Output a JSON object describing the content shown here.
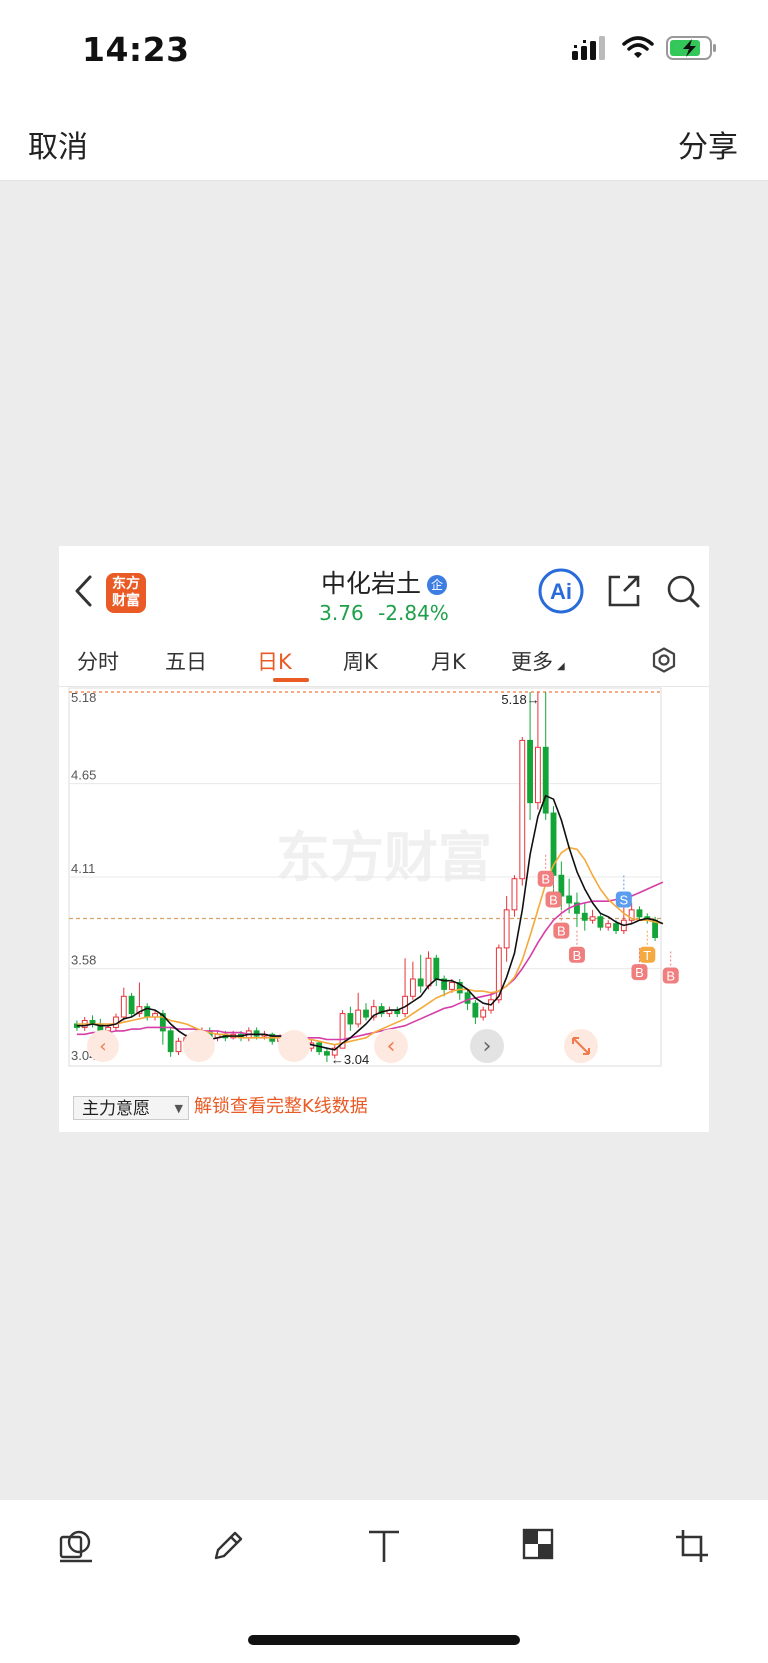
{
  "status": {
    "time": "14:23"
  },
  "topbar": {
    "cancel": "取消",
    "share": "分享"
  },
  "app": {
    "logo_text_line1": "东方",
    "logo_text_line2": "财富",
    "stock_name": "中化岩土",
    "badge": "企",
    "price": "3.76",
    "change_pct": "-2.84%",
    "ai_label": "Ai"
  },
  "tabs": [
    "分时",
    "五日",
    "日K",
    "周K",
    "月K",
    "更多"
  ],
  "active_tab": "日K",
  "indicator": {
    "label": "主力意愿",
    "unlock_text": "解锁查看完整K线数据"
  },
  "watermark": "东方财富",
  "colors": {
    "up": "#e8333a",
    "down": "#13a538",
    "accent": "#ea5a24",
    "ma5": "#111111",
    "ma10": "#f4a93a",
    "ma20": "#d63ca8"
  },
  "chart_data": {
    "type": "candlestick",
    "y_ticks": [
      "5.18",
      "4.65",
      "4.11",
      "3.58",
      "3.04"
    ],
    "ylim": [
      3.04,
      5.18
    ],
    "high_label": "5.18",
    "low_label": "3.04",
    "reference_price": 3.87,
    "candles": [
      {
        "o": 3.26,
        "c": 3.24,
        "h": 3.28,
        "l": 3.22
      },
      {
        "o": 3.24,
        "c": 3.28,
        "h": 3.3,
        "l": 3.22
      },
      {
        "o": 3.28,
        "c": 3.26,
        "h": 3.31,
        "l": 3.24
      },
      {
        "o": 3.26,
        "c": 3.22,
        "h": 3.29,
        "l": 3.18
      },
      {
        "o": 3.22,
        "c": 3.24,
        "h": 3.26,
        "l": 3.2
      },
      {
        "o": 3.24,
        "c": 3.3,
        "h": 3.32,
        "l": 3.22
      },
      {
        "o": 3.3,
        "c": 3.42,
        "h": 3.47,
        "l": 3.28
      },
      {
        "o": 3.42,
        "c": 3.32,
        "h": 3.44,
        "l": 3.3
      },
      {
        "o": 3.32,
        "c": 3.36,
        "h": 3.5,
        "l": 3.3
      },
      {
        "o": 3.36,
        "c": 3.3,
        "h": 3.38,
        "l": 3.28
      },
      {
        "o": 3.3,
        "c": 3.32,
        "h": 3.34,
        "l": 3.28
      },
      {
        "o": 3.32,
        "c": 3.22,
        "h": 3.34,
        "l": 3.14
      },
      {
        "o": 3.22,
        "c": 3.1,
        "h": 3.24,
        "l": 3.07
      },
      {
        "o": 3.1,
        "c": 3.16,
        "h": 3.18,
        "l": 3.08
      },
      {
        "o": 3.16,
        "c": 3.18,
        "h": 3.2,
        "l": 3.12
      },
      {
        "o": 3.18,
        "c": 3.14,
        "h": 3.2,
        "l": 3.12
      },
      {
        "o": 3.14,
        "c": 3.22,
        "h": 3.24,
        "l": 3.12
      },
      {
        "o": 3.22,
        "c": 3.18,
        "h": 3.24,
        "l": 3.16
      },
      {
        "o": 3.18,
        "c": 3.2,
        "h": 3.22,
        "l": 3.16
      },
      {
        "o": 3.2,
        "c": 3.18,
        "h": 3.22,
        "l": 3.16
      },
      {
        "o": 3.18,
        "c": 3.2,
        "h": 3.22,
        "l": 3.17
      },
      {
        "o": 3.2,
        "c": 3.18,
        "h": 3.22,
        "l": 3.16
      },
      {
        "o": 3.18,
        "c": 3.22,
        "h": 3.24,
        "l": 3.16
      },
      {
        "o": 3.22,
        "c": 3.19,
        "h": 3.24,
        "l": 3.17
      },
      {
        "o": 3.19,
        "c": 3.2,
        "h": 3.22,
        "l": 3.17
      },
      {
        "o": 3.2,
        "c": 3.16,
        "h": 3.21,
        "l": 3.14
      },
      {
        "o": 3.16,
        "c": 3.18,
        "h": 3.2,
        "l": 3.14
      },
      {
        "o": 3.18,
        "c": 3.14,
        "h": 3.19,
        "l": 3.12
      },
      {
        "o": 3.14,
        "c": 3.16,
        "h": 3.18,
        "l": 3.12
      },
      {
        "o": 3.16,
        "c": 3.12,
        "h": 3.18,
        "l": 3.1
      },
      {
        "o": 3.12,
        "c": 3.15,
        "h": 3.17,
        "l": 3.1
      },
      {
        "o": 3.15,
        "c": 3.1,
        "h": 3.16,
        "l": 3.08
      },
      {
        "o": 3.1,
        "c": 3.08,
        "h": 3.12,
        "l": 3.04
      },
      {
        "o": 3.08,
        "c": 3.12,
        "h": 3.14,
        "l": 3.06
      },
      {
        "o": 3.12,
        "c": 3.32,
        "h": 3.34,
        "l": 3.12
      },
      {
        "o": 3.32,
        "c": 3.26,
        "h": 3.36,
        "l": 3.22
      },
      {
        "o": 3.26,
        "c": 3.34,
        "h": 3.44,
        "l": 3.24
      },
      {
        "o": 3.34,
        "c": 3.3,
        "h": 3.38,
        "l": 3.28
      },
      {
        "o": 3.3,
        "c": 3.36,
        "h": 3.4,
        "l": 3.28
      },
      {
        "o": 3.36,
        "c": 3.32,
        "h": 3.38,
        "l": 3.3
      },
      {
        "o": 3.32,
        "c": 3.34,
        "h": 3.36,
        "l": 3.3
      },
      {
        "o": 3.34,
        "c": 3.32,
        "h": 3.36,
        "l": 3.3
      },
      {
        "o": 3.32,
        "c": 3.42,
        "h": 3.64,
        "l": 3.3
      },
      {
        "o": 3.42,
        "c": 3.52,
        "h": 3.62,
        "l": 3.4
      },
      {
        "o": 3.52,
        "c": 3.48,
        "h": 3.66,
        "l": 3.44
      },
      {
        "o": 3.48,
        "c": 3.64,
        "h": 3.68,
        "l": 3.46
      },
      {
        "o": 3.64,
        "c": 3.52,
        "h": 3.66,
        "l": 3.48
      },
      {
        "o": 3.52,
        "c": 3.46,
        "h": 3.54,
        "l": 3.42
      },
      {
        "o": 3.46,
        "c": 3.5,
        "h": 3.52,
        "l": 3.44
      },
      {
        "o": 3.5,
        "c": 3.44,
        "h": 3.52,
        "l": 3.4
      },
      {
        "o": 3.44,
        "c": 3.38,
        "h": 3.46,
        "l": 3.34
      },
      {
        "o": 3.38,
        "c": 3.3,
        "h": 3.4,
        "l": 3.26
      },
      {
        "o": 3.3,
        "c": 3.34,
        "h": 3.36,
        "l": 3.28
      },
      {
        "o": 3.34,
        "c": 3.4,
        "h": 3.44,
        "l": 3.32
      },
      {
        "o": 3.4,
        "c": 3.7,
        "h": 3.72,
        "l": 3.38
      },
      {
        "o": 3.7,
        "c": 3.92,
        "h": 4.0,
        "l": 3.62
      },
      {
        "o": 3.92,
        "c": 4.1,
        "h": 4.12,
        "l": 3.88
      },
      {
        "o": 4.1,
        "c": 4.9,
        "h": 4.92,
        "l": 4.06
      },
      {
        "o": 4.9,
        "c": 4.54,
        "h": 5.18,
        "l": 4.44
      },
      {
        "o": 4.54,
        "c": 4.86,
        "h": 5.18,
        "l": 4.5
      },
      {
        "o": 4.86,
        "c": 4.48,
        "h": 5.18,
        "l": 4.44
      },
      {
        "o": 4.48,
        "c": 4.12,
        "h": 4.52,
        "l": 4.0
      },
      {
        "o": 4.12,
        "c": 4.0,
        "h": 4.2,
        "l": 3.92
      },
      {
        "o": 4.0,
        "c": 3.96,
        "h": 4.1,
        "l": 3.9
      },
      {
        "o": 3.96,
        "c": 3.9,
        "h": 4.02,
        "l": 3.82
      },
      {
        "o": 3.9,
        "c": 3.86,
        "h": 3.96,
        "l": 3.8
      },
      {
        "o": 3.86,
        "c": 3.88,
        "h": 3.92,
        "l": 3.84
      },
      {
        "o": 3.88,
        "c": 3.82,
        "h": 3.9,
        "l": 3.8
      },
      {
        "o": 3.82,
        "c": 3.84,
        "h": 3.86,
        "l": 3.8
      },
      {
        "o": 3.84,
        "c": 3.8,
        "h": 3.86,
        "l": 3.78
      },
      {
        "o": 3.8,
        "c": 3.86,
        "h": 3.94,
        "l": 3.78
      },
      {
        "o": 3.86,
        "c": 3.92,
        "h": 3.96,
        "l": 3.84
      },
      {
        "o": 3.92,
        "c": 3.88,
        "h": 3.94,
        "l": 3.86
      },
      {
        "o": 3.88,
        "c": 3.86,
        "h": 3.9,
        "l": 3.84
      },
      {
        "o": 3.86,
        "c": 3.76,
        "h": 3.88,
        "l": 3.74
      }
    ],
    "ma5": [
      3.25,
      3.25,
      3.26,
      3.25,
      3.25,
      3.26,
      3.29,
      3.3,
      3.33,
      3.35,
      3.34,
      3.31,
      3.26,
      3.22,
      3.19,
      3.16,
      3.16,
      3.17,
      3.18,
      3.19,
      3.19,
      3.19,
      3.2,
      3.2,
      3.2,
      3.19,
      3.19,
      3.17,
      3.16,
      3.15,
      3.14,
      3.13,
      3.12,
      3.11,
      3.15,
      3.18,
      3.22,
      3.26,
      3.31,
      3.33,
      3.34,
      3.34,
      3.36,
      3.39,
      3.42,
      3.48,
      3.52,
      3.51,
      3.51,
      3.49,
      3.46,
      3.41,
      3.38,
      3.37,
      3.42,
      3.53,
      3.67,
      3.92,
      4.24,
      4.46,
      4.58,
      4.56,
      4.44,
      4.28,
      4.14,
      4.04,
      3.96,
      3.9,
      3.88,
      3.85,
      3.83,
      3.84,
      3.86,
      3.87,
      3.86,
      3.84
    ],
    "ma10": [
      3.26,
      3.26,
      3.26,
      3.26,
      3.26,
      3.26,
      3.27,
      3.28,
      3.29,
      3.3,
      3.3,
      3.3,
      3.28,
      3.27,
      3.26,
      3.24,
      3.22,
      3.21,
      3.2,
      3.2,
      3.19,
      3.18,
      3.18,
      3.18,
      3.18,
      3.18,
      3.18,
      3.18,
      3.17,
      3.17,
      3.17,
      3.16,
      3.15,
      3.14,
      3.15,
      3.16,
      3.17,
      3.18,
      3.21,
      3.23,
      3.25,
      3.27,
      3.29,
      3.32,
      3.35,
      3.38,
      3.41,
      3.43,
      3.45,
      3.46,
      3.46,
      3.45,
      3.45,
      3.44,
      3.45,
      3.48,
      3.53,
      3.63,
      3.77,
      3.92,
      4.07,
      4.18,
      4.25,
      4.28,
      4.27,
      4.21,
      4.12,
      4.04,
      3.98,
      3.94,
      3.9,
      3.87,
      3.86,
      3.86,
      3.85,
      3.84
    ],
    "ma20": [
      3.2,
      3.2,
      3.21,
      3.21,
      3.21,
      3.22,
      3.22,
      3.23,
      3.23,
      3.24,
      3.24,
      3.24,
      3.24,
      3.23,
      3.23,
      3.23,
      3.22,
      3.22,
      3.22,
      3.21,
      3.21,
      3.21,
      3.2,
      3.2,
      3.2,
      3.19,
      3.19,
      3.19,
      3.19,
      3.18,
      3.18,
      3.18,
      3.17,
      3.17,
      3.17,
      3.18,
      3.19,
      3.2,
      3.21,
      3.22,
      3.23,
      3.24,
      3.25,
      3.27,
      3.29,
      3.31,
      3.33,
      3.35,
      3.36,
      3.38,
      3.4,
      3.41,
      3.42,
      3.43,
      3.45,
      3.48,
      3.52,
      3.58,
      3.65,
      3.73,
      3.8,
      3.86,
      3.9,
      3.93,
      3.95,
      3.96,
      3.97,
      3.97,
      3.97,
      3.98,
      3.99,
      4.0,
      4.02,
      4.04,
      4.06,
      4.08
    ],
    "signals": [
      {
        "i": 60,
        "type": "B",
        "price": 4.1
      },
      {
        "i": 61,
        "type": "B",
        "price": 3.98
      },
      {
        "i": 62,
        "type": "B",
        "price": 3.8
      },
      {
        "i": 64,
        "type": "B",
        "price": 3.66
      },
      {
        "i": 70,
        "type": "S",
        "price": 3.98
      },
      {
        "i": 73,
        "type": "T",
        "price": 3.66
      },
      {
        "i": 72,
        "type": "B",
        "price": 3.56
      },
      {
        "i": 76,
        "type": "B",
        "price": 3.54
      }
    ]
  }
}
